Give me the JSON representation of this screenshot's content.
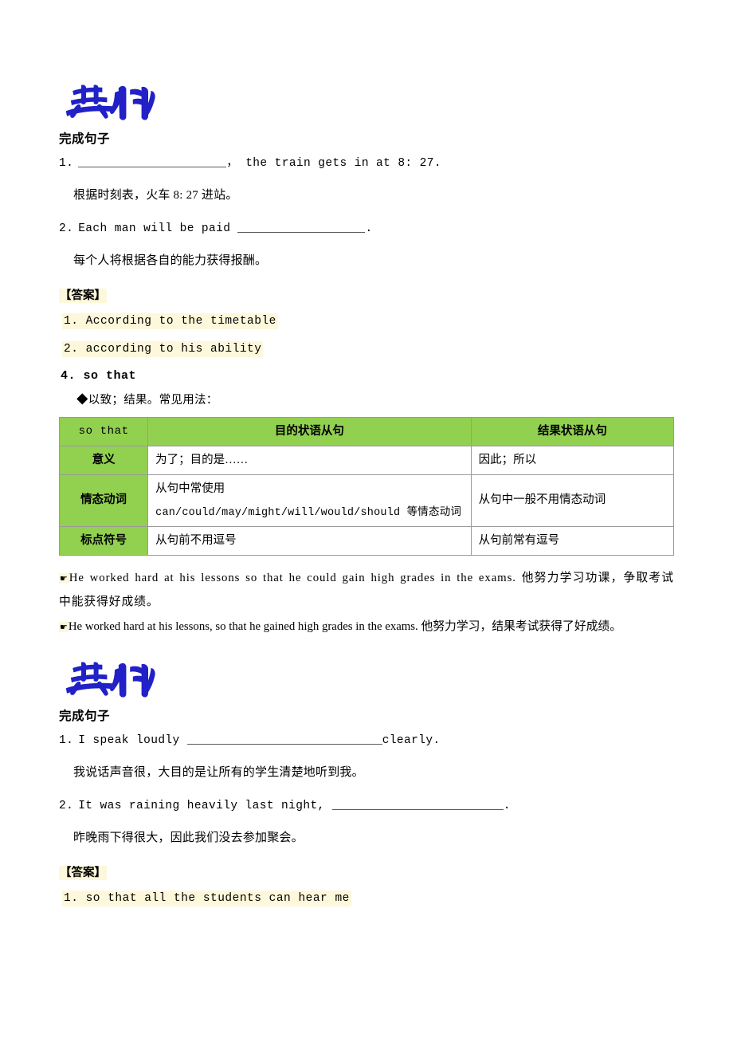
{
  "document": {
    "logo_text": "典例",
    "sections": [
      {
        "id": "example-block-1",
        "heading": "完成句子",
        "questions": [
          {
            "num": "1.",
            "before": "",
            "after": "， the train gets in at 8: 27.",
            "translation": "根据时刻表，火车 8: 27 进站。"
          },
          {
            "num": "2.",
            "before": "Each man will be paid ",
            "after": ".",
            "translation": "每个人将根据各自的能力获得报酬。"
          }
        ],
        "answer_label": "【答案】",
        "answers": [
          "1. According to the timetable",
          "2. according to his ability"
        ]
      }
    ],
    "grammar_point": {
      "number_title": "4. so that",
      "note": "◆以致；结果。常见用法：",
      "table": {
        "header": [
          "so that",
          "目的状语从句",
          "结果状语从句"
        ],
        "rows": [
          {
            "label": "意义",
            "middle": [
              "为了；目的是……"
            ],
            "right": [
              "因此；所以"
            ]
          },
          {
            "label": "情态动词",
            "middle": [
              "从句中常使用",
              "can/could/may/might/will/would/should 等情态动词"
            ],
            "right": [
              "从句中一般不用情态动词"
            ]
          },
          {
            "label": "标点符号",
            "middle": [
              "从句前不用逗号"
            ],
            "right": [
              "从句前常有逗号"
            ]
          }
        ]
      },
      "examples": [
        {
          "marker": "☛",
          "english": "He worked hard at his lessons so that he could gain high grades in the exams.",
          "chinese": "他努力学习功课，争取考试中能获得好成绩。"
        },
        {
          "marker": "☛",
          "english": "He worked hard at his lessons, so that he gained high grades in the exams.",
          "chinese": "他努力学习，结果考试获得了好成绩。"
        }
      ]
    },
    "second_example_block": {
      "heading": "完成句子",
      "questions": [
        {
          "num": "1.",
          "before": "I speak loudly ",
          "after": "clearly.",
          "translation": "我说话声音很，大目的是让所有的学生清楚地听到我。"
        },
        {
          "num": "2.",
          "before": "It was raining heavily last night, ",
          "after": ".",
          "translation": "昨晚雨下得很大，因此我们没去参加聚会。"
        }
      ],
      "answer_label": "【答案】",
      "answers": [
        "1. so that all the students can hear me"
      ]
    },
    "colors": {
      "table_header_green": "#92d050",
      "highlight_yellow": "#fdf8db",
      "logo_blue": "#2020c8",
      "text_black": "#000000"
    }
  }
}
